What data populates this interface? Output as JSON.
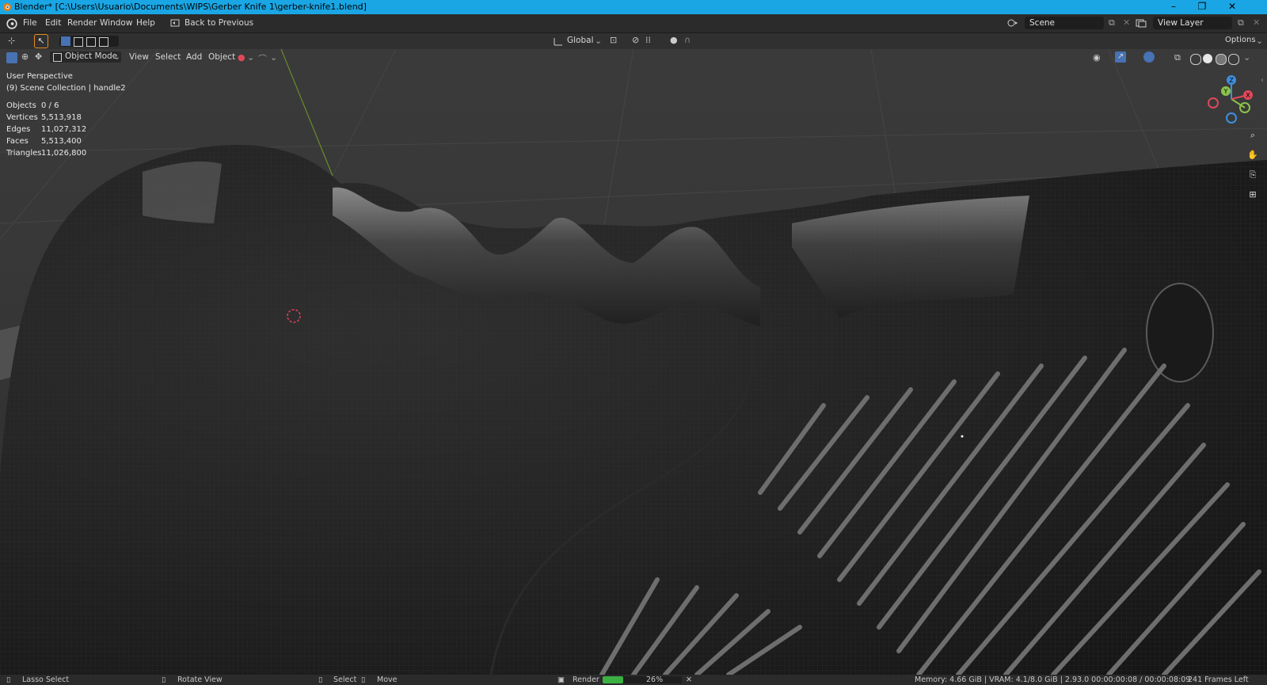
{
  "window": {
    "title": "Blender* [C:\\Users\\Usuario\\Documents\\WIPS\\Gerber Knife 1\\gerber-knife1.blend]",
    "controls": [
      "–",
      "❐",
      "✕"
    ]
  },
  "menu": {
    "items": [
      "File",
      "Edit",
      "Render",
      "Window",
      "Help"
    ],
    "back_label": "Back to Previous"
  },
  "scene": {
    "name": "Scene",
    "view_layer": "View Layer"
  },
  "toolbar": {
    "orientation": "Global",
    "options_label": "Options"
  },
  "header": {
    "mode": "Object Mode",
    "menus": [
      "View",
      "Select",
      "Add",
      "Object"
    ]
  },
  "viewport": {
    "perspective": "User Perspective",
    "collection": "(9) Scene Collection | handle2"
  },
  "stats": [
    {
      "label": "Objects",
      "value": "0 / 6"
    },
    {
      "label": "Vertices",
      "value": "5,513,918"
    },
    {
      "label": "Edges",
      "value": "11,027,312"
    },
    {
      "label": "Faces",
      "value": "5,513,400"
    },
    {
      "label": "Triangles",
      "value": "11,026,800"
    }
  ],
  "gizmo": {
    "z": "Z",
    "y": "Y",
    "x": "X"
  },
  "status": {
    "lasso": "Lasso Select",
    "rotate": "Rotate View",
    "select": "Select",
    "move": "Move",
    "render_label": "Render",
    "render_progress_pct": "26%",
    "render_progress": 0.26,
    "info": "Memory: 4.66 GiB | VRAM: 4.1/8.0 GiB | 2.93.0   00:00:00:08 / 00:00:08:09",
    "frames_left": "241 Frames Left"
  },
  "colors": {
    "titlebar": "#1aa6e4",
    "accent_blue": "#4772b3",
    "progress_green": "#3cb043",
    "axis_x": "#e0485a",
    "axis_y": "#8bc34a",
    "axis_z": "#3d8fe0"
  }
}
